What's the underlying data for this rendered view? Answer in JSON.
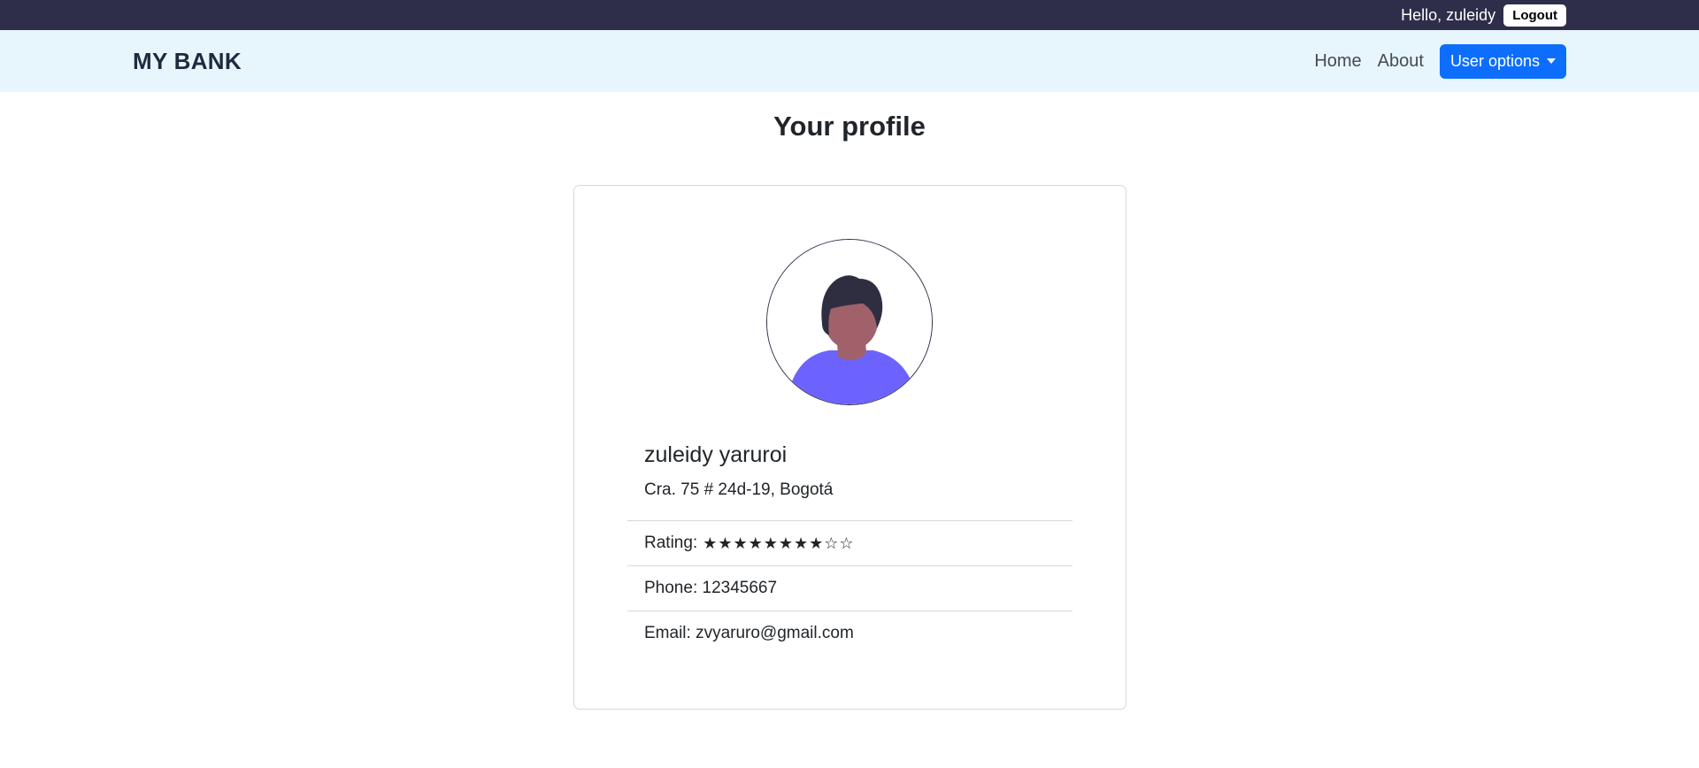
{
  "topbar": {
    "greeting": "Hello, zuleidy",
    "logout_label": "Logout"
  },
  "navbar": {
    "brand": "MY BANK",
    "links": [
      {
        "label": "Home"
      },
      {
        "label": "About"
      }
    ],
    "user_options_label": "User options"
  },
  "page": {
    "title": "Your profile"
  },
  "profile": {
    "name": "zuleidy yaruroi",
    "address": "Cra. 75 # 24d-19, Bogotá",
    "rating_label": "Rating:",
    "rating_stars": "★★★★★★★★☆☆",
    "rating_value": 8,
    "rating_max": 10,
    "phone": "Phone: 12345667",
    "email": "Email: zvyaruro@gmail.com"
  },
  "colors": {
    "topbar_bg": "#2e2e4a",
    "navbar_bg": "#e7f5fd",
    "accent": "#0d6efd",
    "avatar_shirt": "#6c63ff",
    "avatar_skin": "#a0616a",
    "avatar_hair": "#2f2e41"
  },
  "icons": {
    "avatar": "person-avatar-icon",
    "dropdown": "caret-down-icon"
  }
}
